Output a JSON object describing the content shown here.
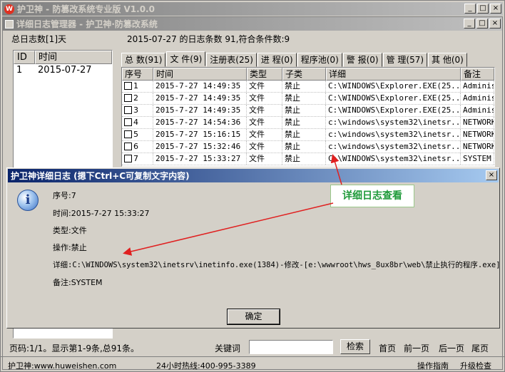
{
  "app": {
    "title": "护卫神 - 防篡改系统专业版 V1.0.0",
    "controls": [
      "_",
      "□",
      "×"
    ]
  },
  "manager": {
    "title": "详细日志管理器 - 护卫神·防篡改系统",
    "total_days": "总日志数[1]天",
    "day_summary": "2015-07-27 的日志条数 91,符合条件数:9"
  },
  "date_list": {
    "headers": [
      "ID",
      "时间"
    ],
    "rows": [
      {
        "id": "1",
        "date": "2015-07-27"
      }
    ]
  },
  "tabs": [
    "总 数(91)",
    "文 件(9)",
    "注册表(25)",
    "进 程(0)",
    "程序池(0)",
    "警 报(0)",
    "管 理(57)",
    "其 他(0)"
  ],
  "table": {
    "headers": [
      "序号",
      "时间",
      "类型",
      "子类",
      "详细",
      "备注"
    ],
    "rows": [
      {
        "no": "1",
        "time": "2015-7-27 14:49:35",
        "type": "文件",
        "sub": "禁止",
        "detail": "C:\\WINDOWS\\Explorer.EXE(25...",
        "note": "Adminis"
      },
      {
        "no": "2",
        "time": "2015-7-27 14:49:35",
        "type": "文件",
        "sub": "禁止",
        "detail": "C:\\WINDOWS\\Explorer.EXE(25...",
        "note": "Adminis"
      },
      {
        "no": "3",
        "time": "2015-7-27 14:49:35",
        "type": "文件",
        "sub": "禁止",
        "detail": "C:\\WINDOWS\\Explorer.EXE(25...",
        "note": "Adminis"
      },
      {
        "no": "4",
        "time": "2015-7-27 14:54:36",
        "type": "文件",
        "sub": "禁止",
        "detail": "c:\\windows\\system32\\inetsr...",
        "note": "NETWORK"
      },
      {
        "no": "5",
        "time": "2015-7-27 15:16:15",
        "type": "文件",
        "sub": "禁止",
        "detail": "c:\\windows\\system32\\inetsr...",
        "note": "NETWORK"
      },
      {
        "no": "6",
        "time": "2015-7-27 15:32:46",
        "type": "文件",
        "sub": "禁止",
        "detail": "c:\\windows\\system32\\inetsr...",
        "note": "NETWORK"
      },
      {
        "no": "7",
        "time": "2015-7-27 15:33:27",
        "type": "文件",
        "sub": "禁止",
        "detail": "C:\\WINDOWS\\system32\\inetsr...",
        "note": "SYSTEM"
      }
    ]
  },
  "dialog": {
    "title": "护卫神详细日志 (摁下Ctrl+C可复制文字内容)",
    "close": "×",
    "seq": "序号:7",
    "time": "时间:2015-7-27 15:33:27",
    "type": "类型:文件",
    "op": "操作:禁止",
    "detail": "详细:C:\\WINDOWS\\system32\\inetsrv\\inetinfo.exe(1384)-修改-[e:\\wwwroot\\hws_8ux8br\\web\\禁止执行的程序.exe]",
    "note": "备注:SYSTEM",
    "ok": "确定"
  },
  "annotation": "详细日志查看",
  "pager": {
    "info": "页码:1/1。显示第1-9条,总91条。",
    "keyword_label": "关键词",
    "keyword_value": "",
    "search": "检索",
    "first": "首页",
    "prev": "前一页",
    "next": "后一页",
    "last": "尾页"
  },
  "status": {
    "site": "护卫神:www.huweishen.com",
    "hotline": "24小时热线:400-995-3389",
    "guide": "操作指南",
    "upgrade": "升级检查"
  }
}
